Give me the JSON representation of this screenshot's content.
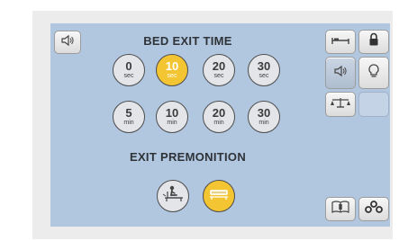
{
  "sections": {
    "bed_exit_time_title": "BED EXIT TIME",
    "exit_premonition_title": "EXIT PREMONITION"
  },
  "bed_exit_time_options": [
    {
      "value": "0",
      "unit": "sec",
      "selected": false
    },
    {
      "value": "10",
      "unit": "sec",
      "selected": true
    },
    {
      "value": "20",
      "unit": "sec",
      "selected": false
    },
    {
      "value": "30",
      "unit": "sec",
      "selected": false
    },
    {
      "value": "5",
      "unit": "min",
      "selected": false
    },
    {
      "value": "10",
      "unit": "min",
      "selected": false
    },
    {
      "value": "20",
      "unit": "min",
      "selected": false
    },
    {
      "value": "30",
      "unit": "min",
      "selected": false
    }
  ],
  "exit_premonition_options": [
    {
      "icon": "patient-sitting-up-icon",
      "selected": false
    },
    {
      "icon": "bed-exit-alarm-icon",
      "selected": true
    }
  ],
  "side_toolbar": [
    {
      "icon": "bed-icon",
      "active": false
    },
    {
      "icon": "lock-icon",
      "active": false
    },
    {
      "icon": "speaker-icon",
      "active": true
    },
    {
      "icon": "lightbulb-icon",
      "active": false
    },
    {
      "icon": "scale-icon",
      "active": false
    }
  ],
  "bottom_toolbar": [
    {
      "icon": "manual-book-icon"
    },
    {
      "icon": "settings-dots-icon"
    }
  ],
  "top_left_button": {
    "icon": "speaker-icon"
  },
  "colors": {
    "screen_background": "#b1c6df",
    "selected": "#f3c532",
    "unselected": "#e3e5e8"
  }
}
